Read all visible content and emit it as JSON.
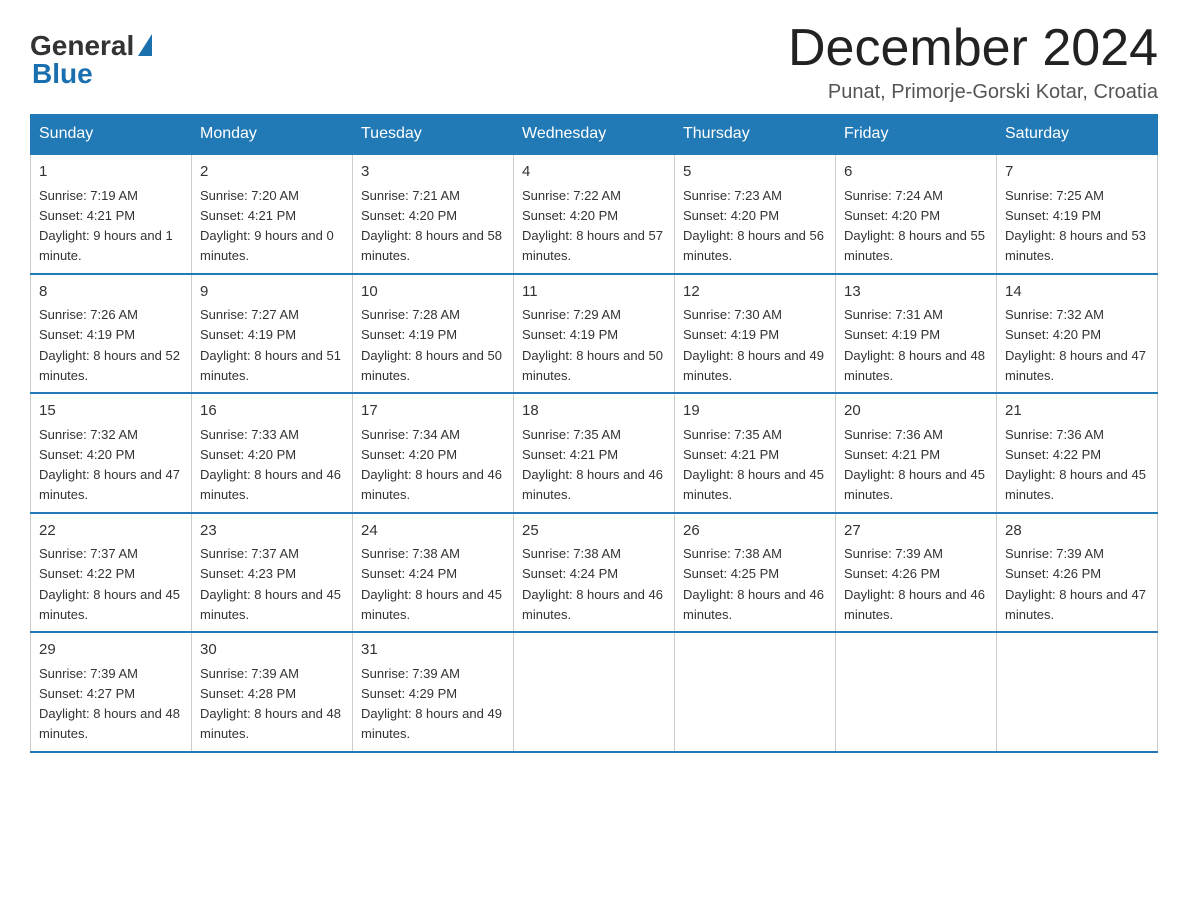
{
  "logo": {
    "general": "General",
    "blue": "Blue"
  },
  "title": {
    "month_year": "December 2024",
    "location": "Punat, Primorje-Gorski Kotar, Croatia"
  },
  "weekdays": [
    "Sunday",
    "Monday",
    "Tuesday",
    "Wednesday",
    "Thursday",
    "Friday",
    "Saturday"
  ],
  "weeks": [
    [
      {
        "day": "1",
        "sunrise": "7:19 AM",
        "sunset": "4:21 PM",
        "daylight": "9 hours and 1 minute."
      },
      {
        "day": "2",
        "sunrise": "7:20 AM",
        "sunset": "4:21 PM",
        "daylight": "9 hours and 0 minutes."
      },
      {
        "day": "3",
        "sunrise": "7:21 AM",
        "sunset": "4:20 PM",
        "daylight": "8 hours and 58 minutes."
      },
      {
        "day": "4",
        "sunrise": "7:22 AM",
        "sunset": "4:20 PM",
        "daylight": "8 hours and 57 minutes."
      },
      {
        "day": "5",
        "sunrise": "7:23 AM",
        "sunset": "4:20 PM",
        "daylight": "8 hours and 56 minutes."
      },
      {
        "day": "6",
        "sunrise": "7:24 AM",
        "sunset": "4:20 PM",
        "daylight": "8 hours and 55 minutes."
      },
      {
        "day": "7",
        "sunrise": "7:25 AM",
        "sunset": "4:19 PM",
        "daylight": "8 hours and 53 minutes."
      }
    ],
    [
      {
        "day": "8",
        "sunrise": "7:26 AM",
        "sunset": "4:19 PM",
        "daylight": "8 hours and 52 minutes."
      },
      {
        "day": "9",
        "sunrise": "7:27 AM",
        "sunset": "4:19 PM",
        "daylight": "8 hours and 51 minutes."
      },
      {
        "day": "10",
        "sunrise": "7:28 AM",
        "sunset": "4:19 PM",
        "daylight": "8 hours and 50 minutes."
      },
      {
        "day": "11",
        "sunrise": "7:29 AM",
        "sunset": "4:19 PM",
        "daylight": "8 hours and 50 minutes."
      },
      {
        "day": "12",
        "sunrise": "7:30 AM",
        "sunset": "4:19 PM",
        "daylight": "8 hours and 49 minutes."
      },
      {
        "day": "13",
        "sunrise": "7:31 AM",
        "sunset": "4:19 PM",
        "daylight": "8 hours and 48 minutes."
      },
      {
        "day": "14",
        "sunrise": "7:32 AM",
        "sunset": "4:20 PM",
        "daylight": "8 hours and 47 minutes."
      }
    ],
    [
      {
        "day": "15",
        "sunrise": "7:32 AM",
        "sunset": "4:20 PM",
        "daylight": "8 hours and 47 minutes."
      },
      {
        "day": "16",
        "sunrise": "7:33 AM",
        "sunset": "4:20 PM",
        "daylight": "8 hours and 46 minutes."
      },
      {
        "day": "17",
        "sunrise": "7:34 AM",
        "sunset": "4:20 PM",
        "daylight": "8 hours and 46 minutes."
      },
      {
        "day": "18",
        "sunrise": "7:35 AM",
        "sunset": "4:21 PM",
        "daylight": "8 hours and 46 minutes."
      },
      {
        "day": "19",
        "sunrise": "7:35 AM",
        "sunset": "4:21 PM",
        "daylight": "8 hours and 45 minutes."
      },
      {
        "day": "20",
        "sunrise": "7:36 AM",
        "sunset": "4:21 PM",
        "daylight": "8 hours and 45 minutes."
      },
      {
        "day": "21",
        "sunrise": "7:36 AM",
        "sunset": "4:22 PM",
        "daylight": "8 hours and 45 minutes."
      }
    ],
    [
      {
        "day": "22",
        "sunrise": "7:37 AM",
        "sunset": "4:22 PM",
        "daylight": "8 hours and 45 minutes."
      },
      {
        "day": "23",
        "sunrise": "7:37 AM",
        "sunset": "4:23 PM",
        "daylight": "8 hours and 45 minutes."
      },
      {
        "day": "24",
        "sunrise": "7:38 AM",
        "sunset": "4:24 PM",
        "daylight": "8 hours and 45 minutes."
      },
      {
        "day": "25",
        "sunrise": "7:38 AM",
        "sunset": "4:24 PM",
        "daylight": "8 hours and 46 minutes."
      },
      {
        "day": "26",
        "sunrise": "7:38 AM",
        "sunset": "4:25 PM",
        "daylight": "8 hours and 46 minutes."
      },
      {
        "day": "27",
        "sunrise": "7:39 AM",
        "sunset": "4:26 PM",
        "daylight": "8 hours and 46 minutes."
      },
      {
        "day": "28",
        "sunrise": "7:39 AM",
        "sunset": "4:26 PM",
        "daylight": "8 hours and 47 minutes."
      }
    ],
    [
      {
        "day": "29",
        "sunrise": "7:39 AM",
        "sunset": "4:27 PM",
        "daylight": "8 hours and 48 minutes."
      },
      {
        "day": "30",
        "sunrise": "7:39 AM",
        "sunset": "4:28 PM",
        "daylight": "8 hours and 48 minutes."
      },
      {
        "day": "31",
        "sunrise": "7:39 AM",
        "sunset": "4:29 PM",
        "daylight": "8 hours and 49 minutes."
      },
      null,
      null,
      null,
      null
    ]
  ],
  "labels": {
    "sunrise_prefix": "Sunrise: ",
    "sunset_prefix": "Sunset: ",
    "daylight_prefix": "Daylight: "
  }
}
